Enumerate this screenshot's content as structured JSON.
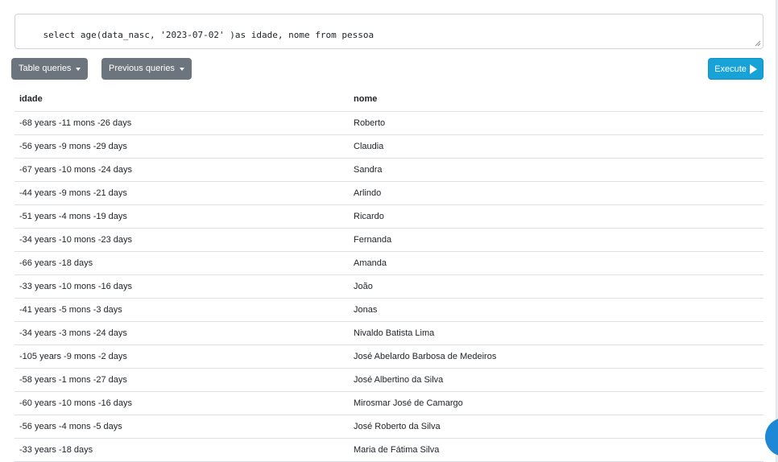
{
  "query": {
    "text": "select age(data_nasc, '2023-07-02' )as idade, nome from pessoa"
  },
  "toolbar": {
    "table_queries_label": "Table queries",
    "previous_queries_label": "Previous queries",
    "execute_label": "Execute"
  },
  "results": {
    "columns": [
      "idade",
      "nome"
    ],
    "rows": [
      [
        "-68 years -11 mons -26 days",
        "Roberto"
      ],
      [
        "-56 years -9 mons -29 days",
        "Claudia"
      ],
      [
        "-67 years -10 mons -24 days",
        "Sandra"
      ],
      [
        "-44 years -9 mons -21 days",
        "Arlindo"
      ],
      [
        "-51 years -4 mons -19 days",
        "Ricardo"
      ],
      [
        "-34 years -10 mons -23 days",
        "Fernanda"
      ],
      [
        "-66 years -18 days",
        "Amanda"
      ],
      [
        "-33 years -10 mons -16 days",
        "João"
      ],
      [
        "-41 years -5 mons -3 days",
        "Jonas"
      ],
      [
        "-34 years -3 mons -24 days",
        "Nivaldo Batista Lima"
      ],
      [
        "-105 years -9 mons -2 days",
        "José Abelardo Barbosa de Medeiros"
      ],
      [
        "-58 years -1 mons -27 days",
        "José Albertino da Silva"
      ],
      [
        "-60 years -10 mons -16 days",
        "Mirosmar José de Camargo"
      ],
      [
        "-56 years -4 mons -5 days",
        "José Roberto da Silva"
      ],
      [
        "-33 years -18 days",
        "Maria de Fátima Silva"
      ]
    ]
  },
  "colors": {
    "secondary_button": "#6c757d",
    "execute_button": "#17a2d8",
    "floating_button": "#1e88d6"
  }
}
